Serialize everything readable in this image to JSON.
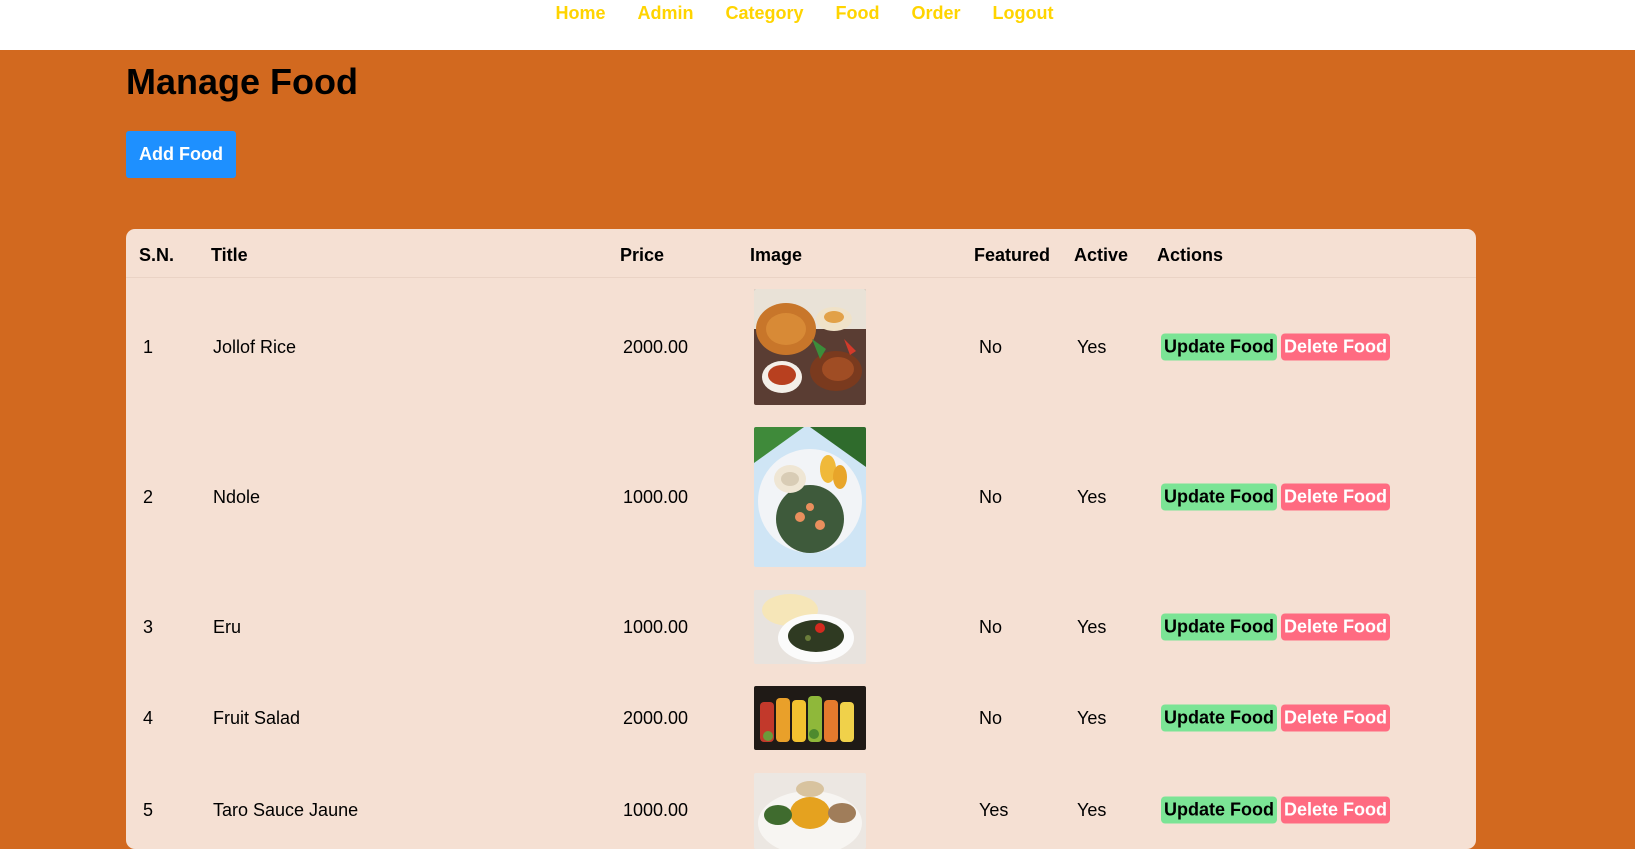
{
  "nav": {
    "items": [
      "Home",
      "Admin",
      "Category",
      "Food",
      "Order",
      "Logout"
    ]
  },
  "page": {
    "title": "Manage Food",
    "add_button": "Add Food"
  },
  "table": {
    "headers": [
      "S.N.",
      "Title",
      "Price",
      "Image",
      "Featured",
      "Active",
      "Actions"
    ],
    "rows": [
      {
        "sn": "1",
        "title": "Jollof Rice",
        "price": "2000.00",
        "featured": "No",
        "active": "Yes",
        "update": "Update Food",
        "delete": "Delete Food",
        "image": "jollof-rice-thumbnail"
      },
      {
        "sn": "2",
        "title": "Ndole",
        "price": "1000.00",
        "featured": "No",
        "active": "Yes",
        "update": "Update Food",
        "delete": "Delete Food",
        "image": "ndole-thumbnail"
      },
      {
        "sn": "3",
        "title": "Eru",
        "price": "1000.00",
        "featured": "No",
        "active": "Yes",
        "update": "Update Food",
        "delete": "Delete Food",
        "image": "eru-thumbnail"
      },
      {
        "sn": "4",
        "title": "Fruit Salad",
        "price": "2000.00",
        "featured": "No",
        "active": "Yes",
        "update": "Update Food",
        "delete": "Delete Food",
        "image": "fruit-salad-thumbnail"
      },
      {
        "sn": "5",
        "title": "Taro Sauce Jaune",
        "price": "1000.00",
        "featured": "Yes",
        "active": "Yes",
        "update": "Update Food",
        "delete": "Delete Food",
        "image": "taro-sauce-jaune-thumbnail"
      }
    ]
  },
  "colors": {
    "page_background": "#d2691f",
    "nav_link": "#ffd400",
    "add_button": "#1e90ff",
    "table_background": "#f5e0d3",
    "update_button": "#7be495",
    "delete_button": "#ff6b81"
  }
}
